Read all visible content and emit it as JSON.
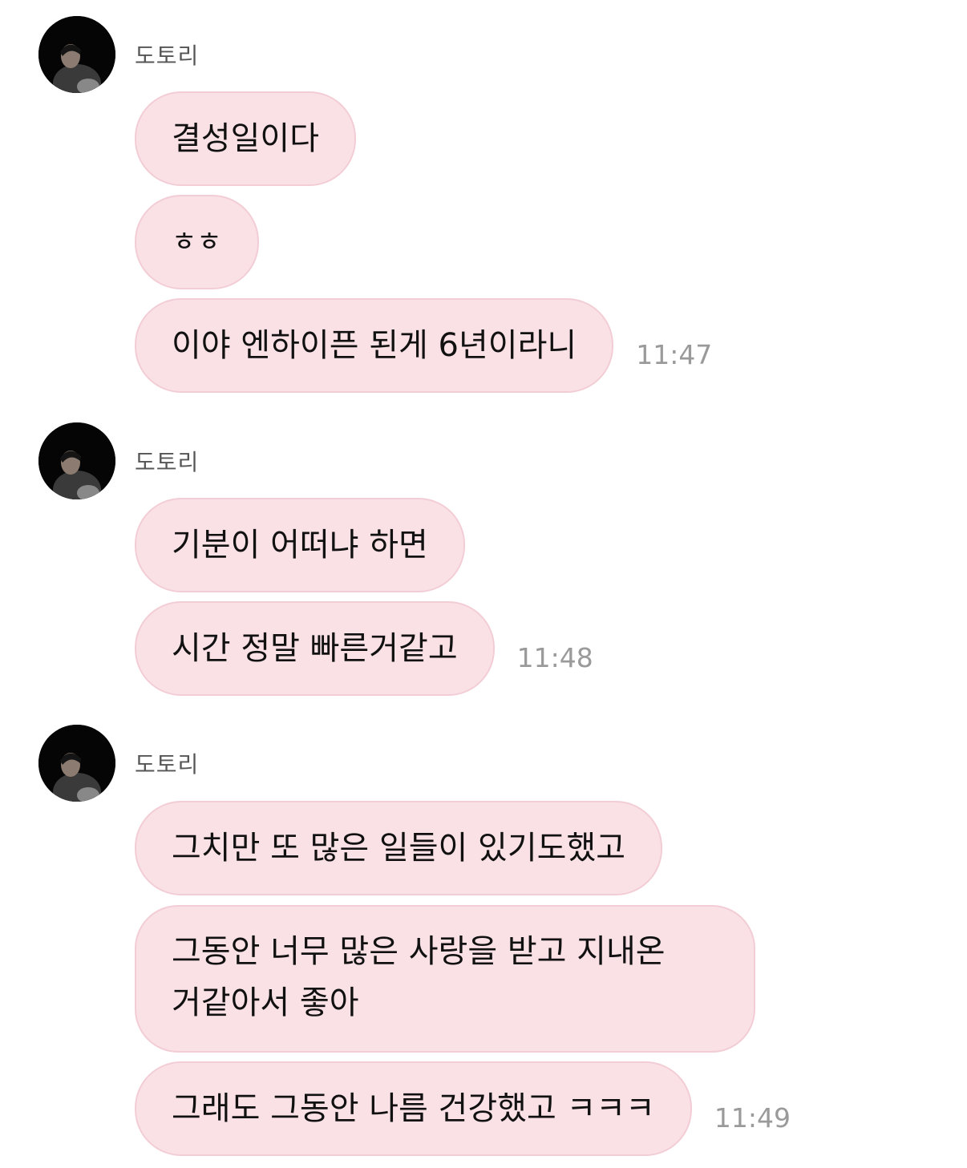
{
  "colors": {
    "bubble_bg": "#f9e1e6",
    "bubble_border": "#f3cdd5",
    "sender_name": "#555555",
    "timestamp": "#9a9a9a",
    "text": "#111111"
  },
  "groups": [
    {
      "sender": "도토리",
      "avatar_icon": "profile-photo-avatar",
      "messages": [
        {
          "text": "결성일이다"
        },
        {
          "text": "ㅎㅎ"
        },
        {
          "text": "이야 엔하이픈 된게 6년이라니",
          "time": "11:47"
        }
      ]
    },
    {
      "sender": "도토리",
      "avatar_icon": "profile-photo-avatar",
      "messages": [
        {
          "text": "기분이 어떠냐 하면"
        },
        {
          "text": "시간 정말 빠른거같고",
          "time": "11:48"
        }
      ]
    },
    {
      "sender": "도토리",
      "avatar_icon": "profile-photo-avatar",
      "messages": [
        {
          "text": "그치만 또 많은 일들이 있기도했고"
        },
        {
          "lines": [
            "그동안 너무 많은 사랑을 받고 지내온",
            "거같아서 좋아"
          ]
        },
        {
          "text": "그래도 그동안 나름 건강했고 ㅋㅋㅋ",
          "time": "11:49"
        }
      ]
    }
  ]
}
